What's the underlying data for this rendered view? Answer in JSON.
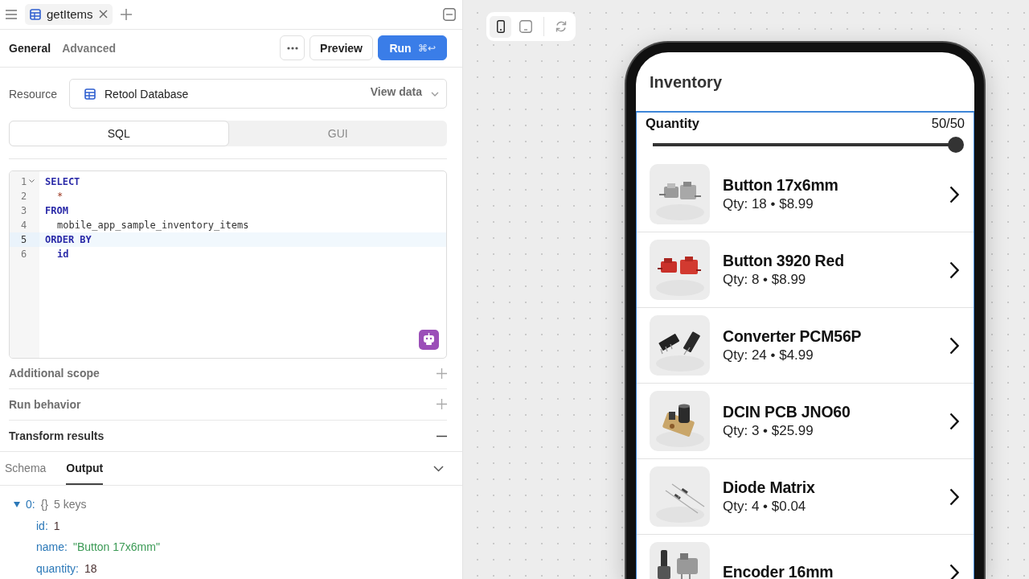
{
  "query_tab": {
    "label": "getItems"
  },
  "editor_tabs": [
    {
      "label": "General",
      "selected": true
    },
    {
      "label": "Advanced",
      "selected": false
    }
  ],
  "actions": {
    "preview": "Preview",
    "run": "Run",
    "shortcut": "⌘↩"
  },
  "resource": {
    "label": "Resource",
    "value": "Retool Database",
    "link": "View data"
  },
  "mode_tabs": [
    {
      "label": "SQL",
      "selected": true
    },
    {
      "label": "GUI",
      "selected": false
    }
  ],
  "code_lines": [
    {
      "number": "1",
      "foldable": true,
      "indented": false,
      "current": false,
      "tokens": [
        {
          "text": "SELECT",
          "kind": "keyword"
        }
      ]
    },
    {
      "number": "2",
      "foldable": false,
      "indented": true,
      "current": false,
      "tokens": [
        {
          "text": "*",
          "kind": "operator"
        }
      ]
    },
    {
      "number": "3",
      "foldable": false,
      "indented": false,
      "current": false,
      "tokens": [
        {
          "text": "FROM",
          "kind": "keyword"
        }
      ]
    },
    {
      "number": "4",
      "foldable": false,
      "indented": true,
      "current": false,
      "tokens": [
        {
          "text": "mobile_app_sample_inventory_items",
          "kind": "plain"
        }
      ]
    },
    {
      "number": "5",
      "foldable": false,
      "indented": false,
      "current": true,
      "tokens": [
        {
          "text": "ORDER BY",
          "kind": "keyword"
        }
      ]
    },
    {
      "number": "6",
      "foldable": false,
      "indented": true,
      "current": false,
      "tokens": [
        {
          "text": "id",
          "kind": "keyword"
        }
      ]
    }
  ],
  "sections": [
    {
      "label": "Additional scope",
      "expanded": false
    },
    {
      "label": "Run behavior",
      "expanded": false
    },
    {
      "label": "Transform results",
      "expanded": true
    }
  ],
  "output_tabs": [
    {
      "label": "Schema",
      "selected": false
    },
    {
      "label": "Output",
      "selected": true
    }
  ],
  "output_tree": [
    {
      "key": "0:",
      "glyph": "{}",
      "summary": "5 keys",
      "expanded": true,
      "children": [
        {
          "key": "id:",
          "value": "1",
          "kind": "number"
        },
        {
          "key": "name:",
          "value": "\"Button 17x6mm\"",
          "kind": "string"
        },
        {
          "key": "quantity:",
          "value": "18",
          "kind": "number"
        }
      ]
    }
  ],
  "view_modes": [
    {
      "kind": "phone",
      "selected": true
    },
    {
      "kind": "tablet",
      "selected": false
    }
  ],
  "phone": {
    "title": "Inventory",
    "filter": {
      "label": "Quantity",
      "reading": "50/50",
      "level": 1
    },
    "items": [
      {
        "name": "Button 17x6mm",
        "detail": "Qty: 18 • $8.99"
      },
      {
        "name": "Button 3920 Red",
        "detail": "Qty: 8 • $8.99"
      },
      {
        "name": "Converter PCM56P",
        "detail": "Qty: 24 • $4.99"
      },
      {
        "name": "DCIN PCB JNO60",
        "detail": "Qty: 3 • $25.99"
      },
      {
        "name": "Diode Matrix",
        "detail": "Qty: 4 • $0.04"
      },
      {
        "name": "Encoder 16mm"
      }
    ]
  }
}
